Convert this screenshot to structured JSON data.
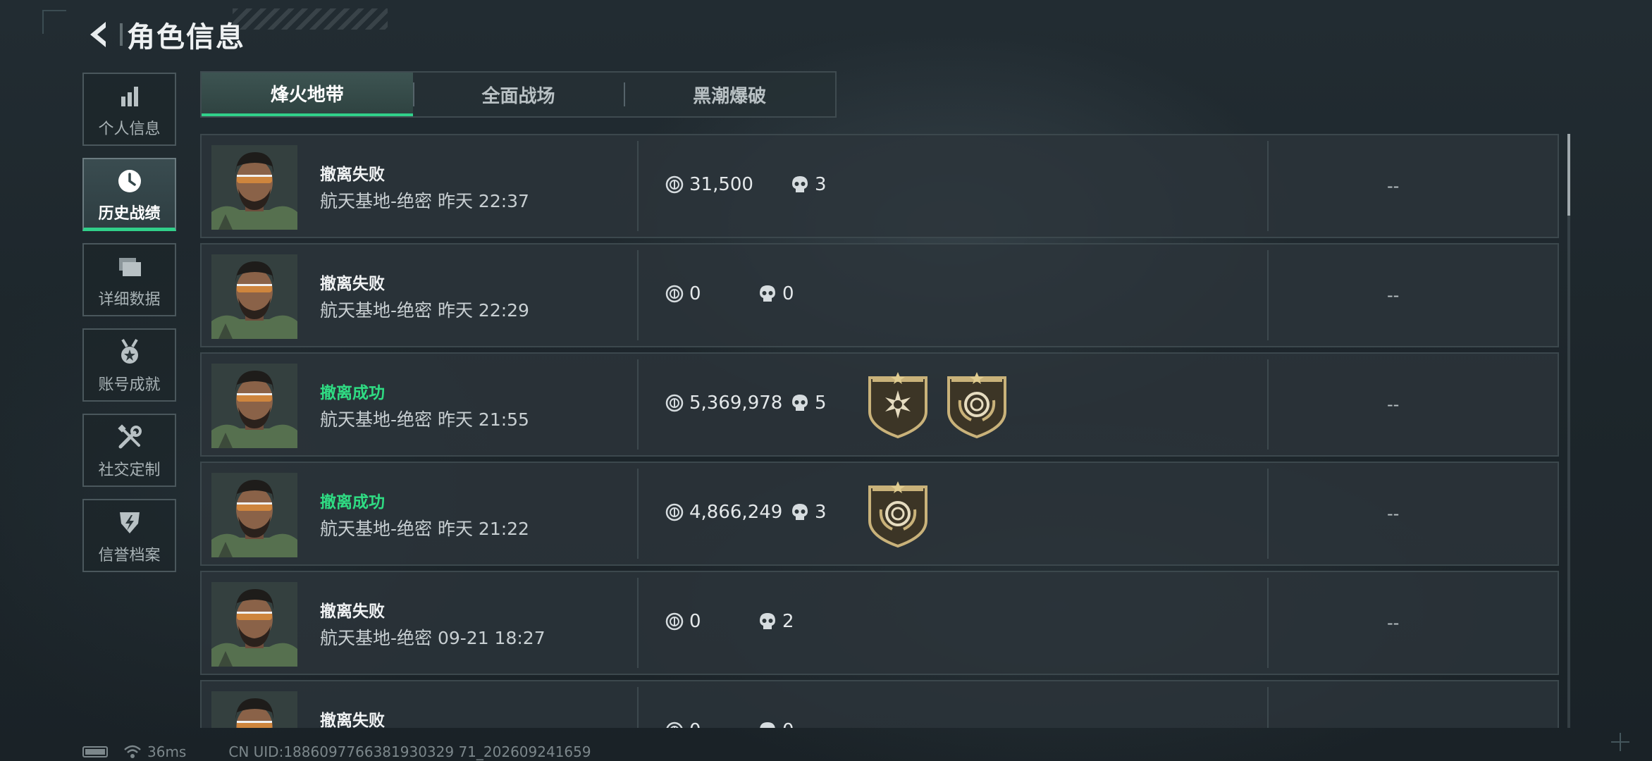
{
  "header": {
    "title": "角色信息"
  },
  "sidebar": {
    "items": [
      {
        "label": "个人信息",
        "icon": "bar-chart-icon"
      },
      {
        "label": "历史战绩",
        "icon": "clock-icon",
        "active": true
      },
      {
        "label": "详细数据",
        "icon": "folders-icon"
      },
      {
        "label": "账号成就",
        "icon": "medal-icon"
      },
      {
        "label": "社交定制",
        "icon": "wrench-screwdriver-icon"
      },
      {
        "label": "信誉档案",
        "icon": "shield-bolt-icon"
      }
    ]
  },
  "tabs": [
    {
      "label": "烽火地带",
      "active": true
    },
    {
      "label": "全面战场"
    },
    {
      "label": "黑潮爆破"
    }
  ],
  "records": [
    {
      "outcome": "撤离失败",
      "success": false,
      "map": "航天基地-绝密 昨天 22:37",
      "money": "31,500",
      "kills": "3",
      "badges": [],
      "extra": "--"
    },
    {
      "outcome": "撤离失败",
      "success": false,
      "map": "航天基地-绝密 昨天 22:29",
      "money": "0",
      "kills": "0",
      "badges": [],
      "extra": "--"
    },
    {
      "outcome": "撤离成功",
      "success": true,
      "map": "航天基地-绝密 昨天 21:55",
      "money": "5,369,978",
      "kills": "5",
      "badges": [
        "star-burst-badge-icon",
        "coin-laurel-badge-icon"
      ],
      "extra": "--"
    },
    {
      "outcome": "撤离成功",
      "success": true,
      "map": "航天基地-绝密 昨天 21:22",
      "money": "4,866,249",
      "kills": "3",
      "badges": [
        "coin-laurel-badge-icon"
      ],
      "extra": "--"
    },
    {
      "outcome": "撤离失败",
      "success": false,
      "map": "航天基地-绝密 09-21 18:27",
      "money": "0",
      "kills": "2",
      "badges": [],
      "extra": "--"
    },
    {
      "outcome": "撤离失败",
      "success": false,
      "map": "",
      "money": "0",
      "kills": "0",
      "badges": [],
      "extra": ""
    }
  ],
  "footer": {
    "ping": "36ms",
    "uid": "CN UID:1886097766381930329 71_202609241659"
  },
  "colors": {
    "accent": "#31d08a",
    "success_text": "#2fdc83"
  }
}
